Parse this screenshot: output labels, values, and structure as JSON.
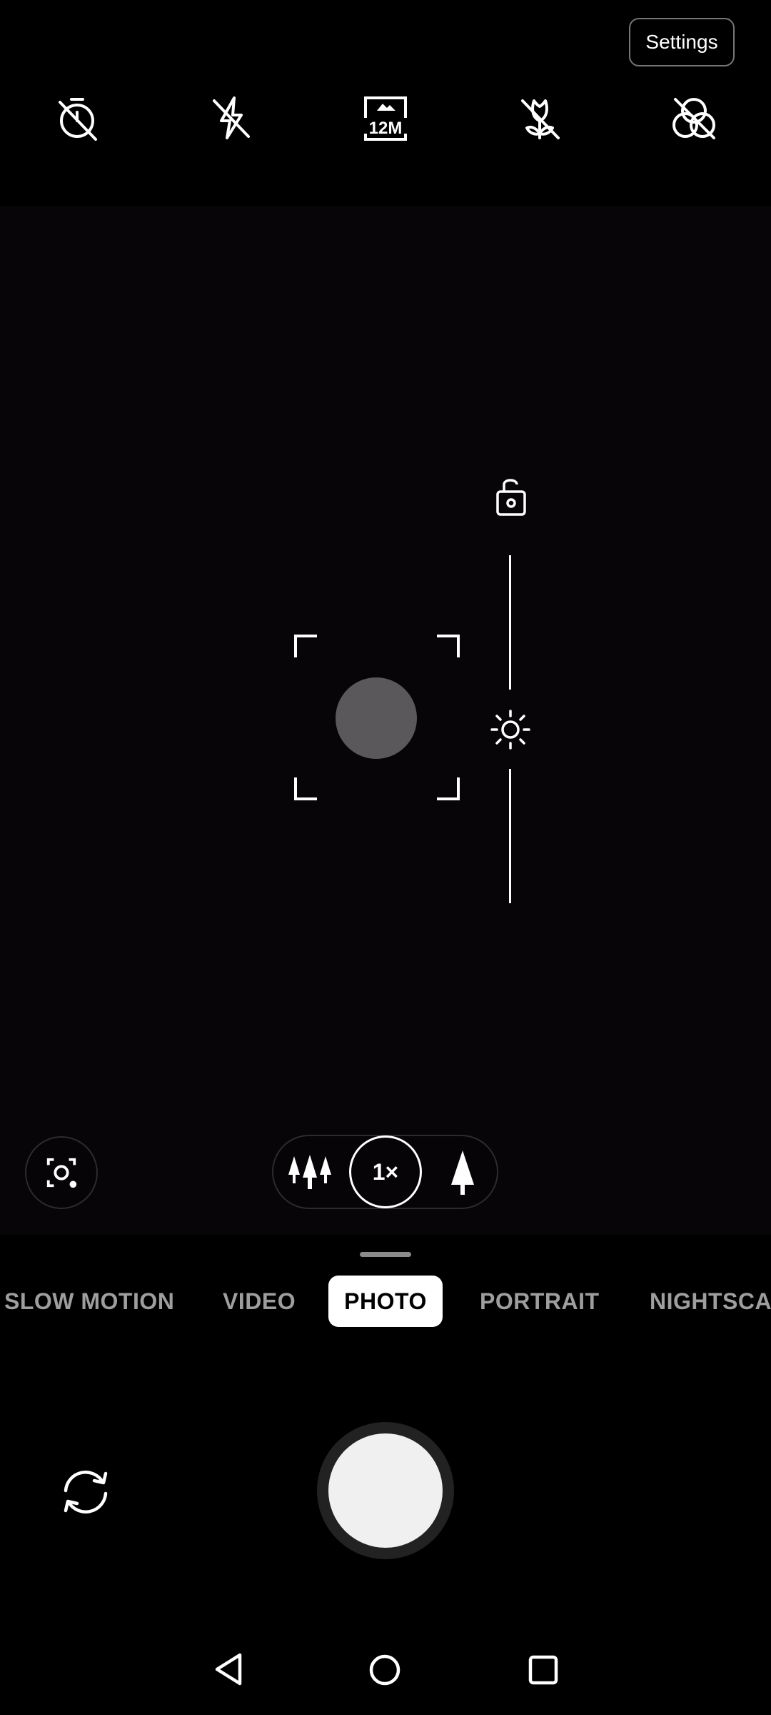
{
  "header": {
    "settings_label": "Settings"
  },
  "top_toolbar": {
    "icons": [
      "timer-off-icon",
      "flash-off-icon",
      "resolution-icon",
      "macro-off-icon",
      "filter-off-icon"
    ],
    "resolution_label": "12M"
  },
  "viewfinder": {
    "exposure_lock_icon": "lock-open-icon",
    "exposure_icon": "sun-icon"
  },
  "zoom": {
    "wide_icon": "trees-icon",
    "current": "1×",
    "tele_icon": "tree-icon"
  },
  "modes": {
    "items": [
      "SLOW MOTION",
      "VIDEO",
      "PHOTO",
      "PORTRAIT",
      "NIGHTSCA"
    ],
    "selected": "PHOTO"
  },
  "controls": {
    "switch_camera_icon": "rotate-camera-icon"
  },
  "navbar": {
    "icons": [
      "back-icon",
      "home-icon",
      "recents-icon"
    ]
  },
  "colors": {
    "background": "#000000",
    "viewfinder": "#080508",
    "accent": "#ffffff",
    "mode_inactive": "#9e9e9e"
  }
}
